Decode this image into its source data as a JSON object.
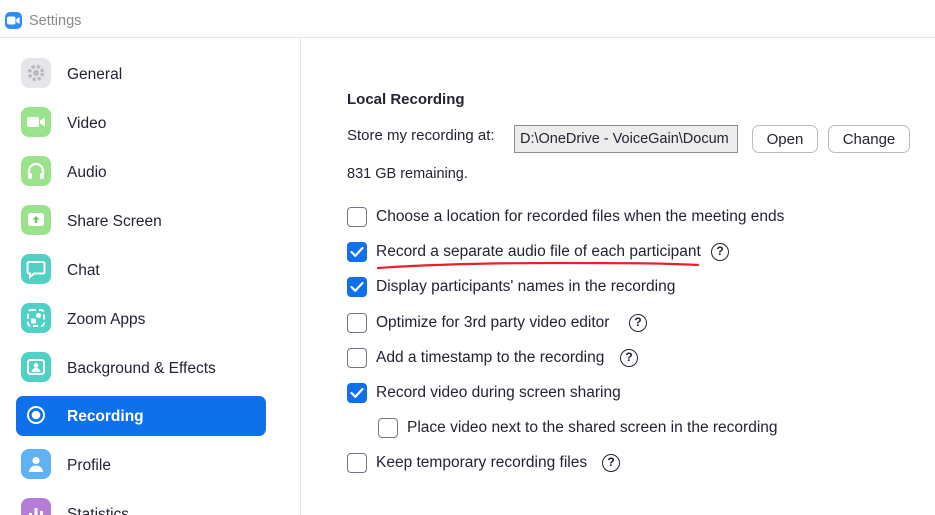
{
  "window": {
    "title": "Settings"
  },
  "sidebar": {
    "items": [
      {
        "label": "General",
        "icon": "gear-icon",
        "color": "#e6e6ea",
        "active": false
      },
      {
        "label": "Video",
        "icon": "video-camera-icon",
        "color": "#9be28c",
        "active": false
      },
      {
        "label": "Audio",
        "icon": "headphones-icon",
        "color": "#9be28c",
        "active": false
      },
      {
        "label": "Share Screen",
        "icon": "share-screen-icon",
        "color": "#9be28c",
        "active": false
      },
      {
        "label": "Chat",
        "icon": "chat-bubble-icon",
        "color": "#4fd1c5",
        "active": false
      },
      {
        "label": "Zoom Apps",
        "icon": "zoom-apps-icon",
        "color": "#4fd1c5",
        "active": false
      },
      {
        "label": "Background & Effects",
        "icon": "background-effects-icon",
        "color": "#4fd1c5",
        "active": false
      },
      {
        "label": "Recording",
        "icon": "record-icon",
        "color": "#0e71eb",
        "active": true
      },
      {
        "label": "Profile",
        "icon": "profile-icon",
        "color": "#5fb3f5",
        "active": false
      },
      {
        "label": "Statistics",
        "icon": "statistics-icon",
        "color": "#b57cd8",
        "active": false
      }
    ]
  },
  "recording": {
    "section_title": "Local Recording",
    "store_label": "Store my recording at:",
    "path_value": "D:\\OneDrive - VoiceGain\\Docum",
    "open_label": "Open",
    "change_label": "Change",
    "remaining": "831 GB remaining.",
    "options": [
      {
        "label": "Choose a location for recorded files when the meeting ends",
        "checked": false,
        "help": false
      },
      {
        "label": "Record a separate audio file of each participant",
        "checked": true,
        "help": true
      },
      {
        "label": "Display participants' names in the recording",
        "checked": true,
        "help": false
      },
      {
        "label": "Optimize for 3rd party video editor",
        "checked": false,
        "help": true
      },
      {
        "label": "Add a timestamp to the recording",
        "checked": false,
        "help": true
      },
      {
        "label": "Record video during screen sharing",
        "checked": true,
        "help": false
      },
      {
        "label": "Place video next to the shared screen in the recording",
        "checked": false,
        "help": false
      },
      {
        "label": "Keep temporary recording files",
        "checked": false,
        "help": true
      }
    ],
    "help_glyph": "?"
  },
  "colors": {
    "accent": "#0e71eb",
    "annotation": "#e8202a"
  }
}
